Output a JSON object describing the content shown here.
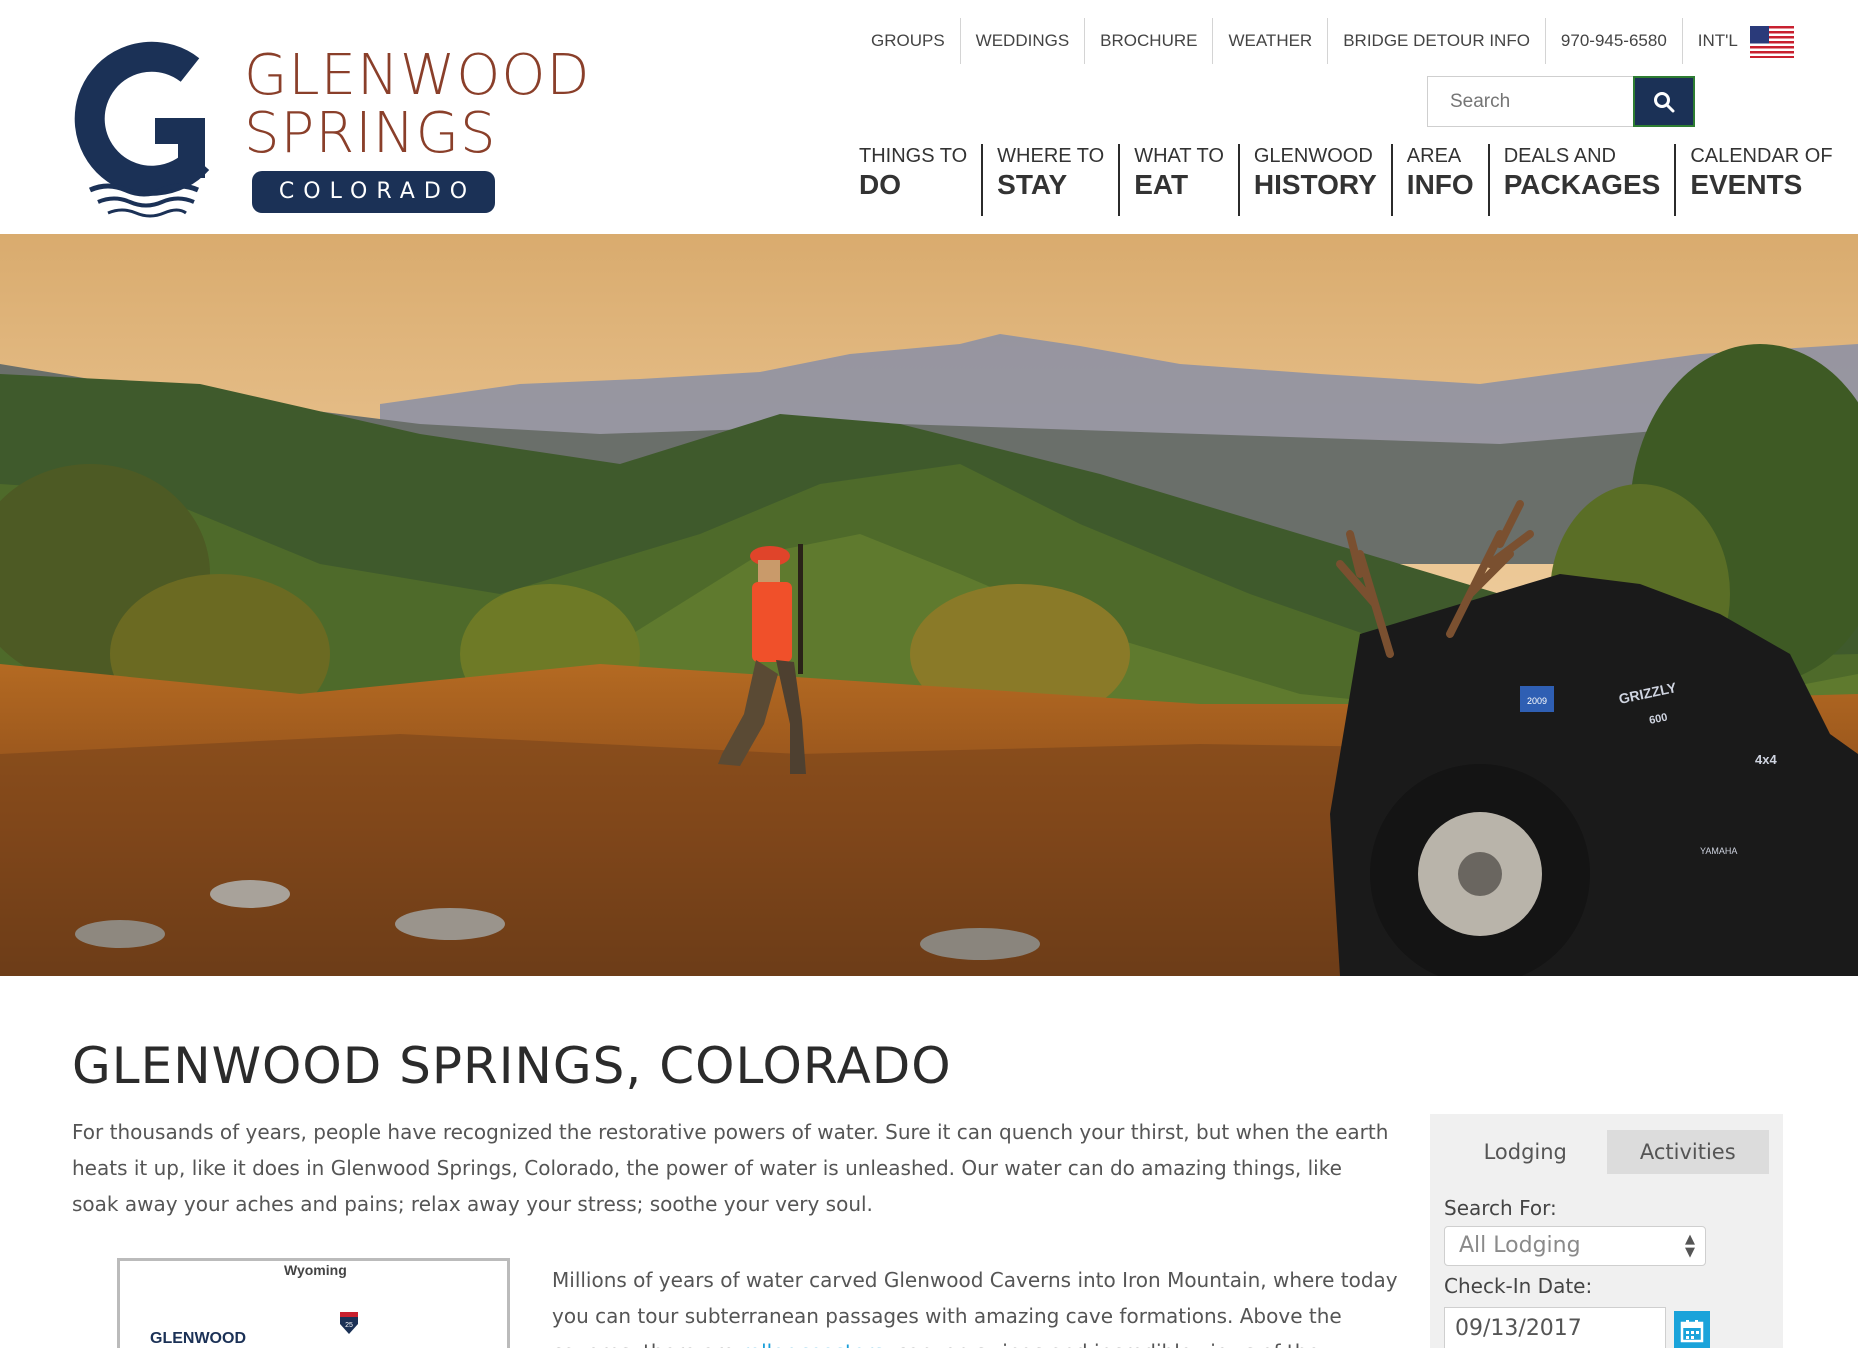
{
  "logo": {
    "line1": "GLENWOOD",
    "line2": "SPRINGS",
    "badge": "COLORADO"
  },
  "utility_nav": [
    {
      "label": "GROUPS"
    },
    {
      "label": "WEDDINGS"
    },
    {
      "label": "BROCHURE"
    },
    {
      "label": "WEATHER"
    },
    {
      "label": "BRIDGE DETOUR INFO"
    },
    {
      "label": "970-945-6580"
    },
    {
      "label": "INT'L",
      "icon": "us-flag-icon"
    }
  ],
  "search": {
    "placeholder": "Search",
    "button_icon": "search-icon"
  },
  "main_nav": [
    {
      "top": "THINGS TO",
      "bottom": "DO"
    },
    {
      "top": "WHERE TO",
      "bottom": "STAY"
    },
    {
      "top": "WHAT TO",
      "bottom": "EAT"
    },
    {
      "top": "GLENWOOD",
      "bottom": "HISTORY"
    },
    {
      "top": "AREA",
      "bottom": "INFO"
    },
    {
      "top": "DEALS AND",
      "bottom": "PACKAGES"
    },
    {
      "top": "CALENDAR OF",
      "bottom": "EVENTS"
    }
  ],
  "hero": {
    "atv_sticker": "2009",
    "atv_brand": "GRIZZLY",
    "atv_model": "600",
    "atv_badge": "4x4",
    "wheel_brand": "YAMAHA"
  },
  "content": {
    "title": "GLENWOOD SPRINGS, COLORADO",
    "intro": "For thousands of years, people have recognized the restorative powers of water. Sure it can quench your thirst, but when the earth heats it up, like it does in Glenwood Springs, Colorado, the power of water is unleashed. Our water can do amazing things, like soak away your aches and pains; relax away your stress; soothe your very soul.",
    "map_state": "Wyoming",
    "map_city": "GLENWOOD",
    "map_highway": "25",
    "para2_before": "Millions of years of water carved Glenwood Caverns into Iron Mountain, where today you can tour subterranean passages with amazing cave formations. Above the caverns, there are ",
    "para2_link": "roller coasters",
    "para2_after": ", canyon swings and incredible views of the Roaring Fork Valley."
  },
  "booking": {
    "tab_lodging": "Lodging",
    "tab_activities": "Activities",
    "search_for_label": "Search For:",
    "search_for_value": "All Lodging",
    "checkin_label": "Check-In Date:",
    "checkin_value": "09/13/2017",
    "calendar_icon": "calendar-icon"
  },
  "colors": {
    "brand_navy": "#1b3156",
    "brand_rust": "#8a3f2a",
    "link_blue": "#1a9fd9"
  }
}
